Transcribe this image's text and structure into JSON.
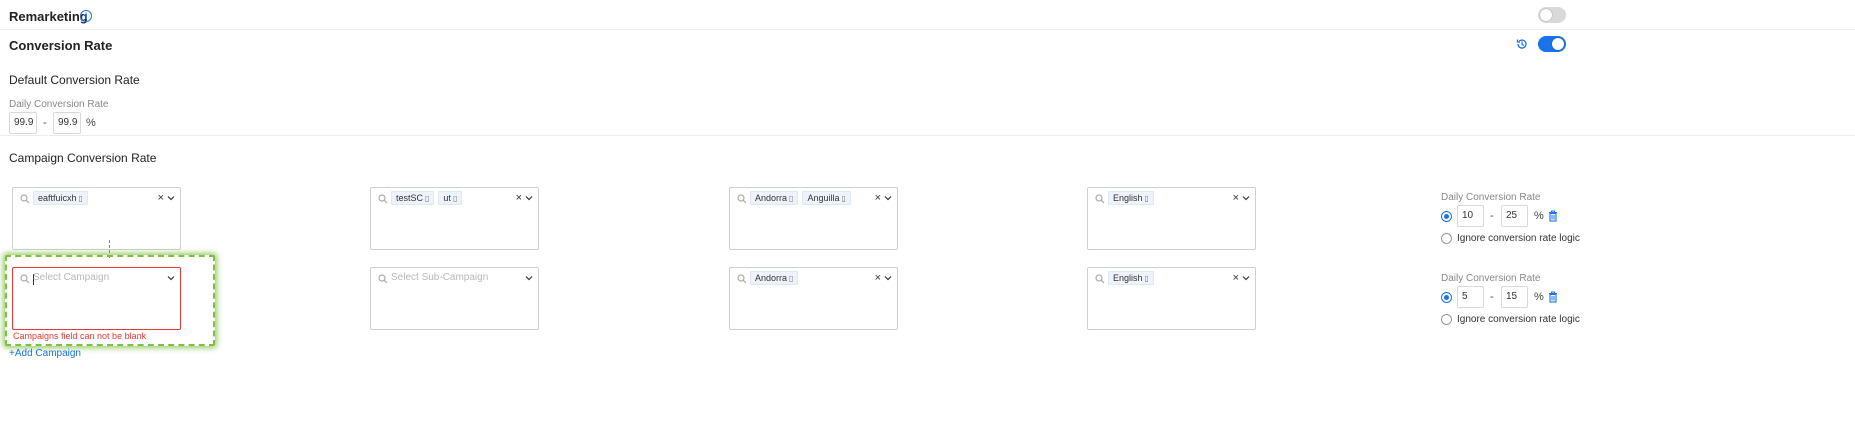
{
  "remarketing": {
    "title": "Remarketing",
    "info_icon": "i",
    "toggle_state": "off"
  },
  "conversion_rate": {
    "title": "Conversion Rate",
    "toggle_state": "on"
  },
  "default": {
    "title": "Default Conversion Rate",
    "daily_label": "Daily Conversion Rate",
    "min": "99.9",
    "max": "99.9",
    "separator": "-",
    "unit": "%"
  },
  "campaign": {
    "title": "Campaign Conversion Rate",
    "rows": [
      {
        "campaigns": {
          "tags": [
            {
              "label": "eaftfuicxh"
            }
          ],
          "placeholder": ""
        },
        "sub_campaigns": {
          "tags": [
            {
              "label": "testSC"
            },
            {
              "label": "ut"
            }
          ],
          "placeholder": ""
        },
        "countries": {
          "tags": [
            {
              "label": "Andorra"
            },
            {
              "label": "Anguilla"
            }
          ]
        },
        "languages": {
          "tags": [
            {
              "label": "English"
            }
          ]
        },
        "daily_label": "Daily Conversion Rate",
        "min": "10",
        "max": "25",
        "separator": "-",
        "unit": "%",
        "ignore_label": "Ignore conversion rate logic"
      },
      {
        "campaigns": {
          "tags": [],
          "placeholder": "Select Campaign",
          "error": "Campaigns field can not be blank"
        },
        "sub_campaigns": {
          "tags": [],
          "placeholder": "Select Sub-Campaign"
        },
        "countries": {
          "tags": [
            {
              "label": "Andorra"
            }
          ]
        },
        "languages": {
          "tags": [
            {
              "label": "English"
            }
          ]
        },
        "daily_label": "Daily Conversion Rate",
        "min": "5",
        "max": "15",
        "separator": "-",
        "unit": "%",
        "ignore_label": "Ignore conversion rate logic"
      }
    ],
    "clear_symbol": "×",
    "tag_remove_symbol": "▯",
    "add_link": "+Add Campaign"
  },
  "colors": {
    "accent": "#1a73e8",
    "error": "#e53935",
    "highlight": "#7dc142"
  }
}
